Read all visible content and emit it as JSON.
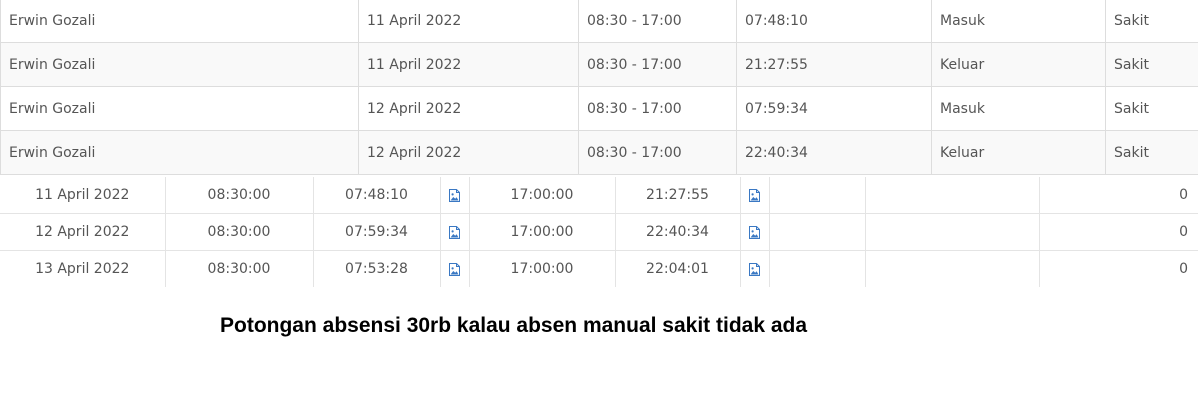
{
  "log_rows": [
    {
      "name": "Erwin Gozali",
      "date": "11 April 2022",
      "shift": "08:30 - 17:00",
      "time": "07:48:10",
      "type": "Masuk",
      "reason": "Sakit"
    },
    {
      "name": "Erwin Gozali",
      "date": "11 April 2022",
      "shift": "08:30 - 17:00",
      "time": "21:27:55",
      "type": "Keluar",
      "reason": "Sakit"
    },
    {
      "name": "Erwin Gozali",
      "date": "12 April 2022",
      "shift": "08:30 - 17:00",
      "time": "07:59:34",
      "type": "Masuk",
      "reason": "Sakit"
    },
    {
      "name": "Erwin Gozali",
      "date": "12 April 2022",
      "shift": "08:30 - 17:00",
      "time": "22:40:34",
      "type": "Keluar",
      "reason": "Sakit"
    }
  ],
  "summary_rows": [
    {
      "date": "11 April 2022",
      "sched_in": "08:30:00",
      "actual_in": "07:48:10",
      "sched_out": "17:00:00",
      "actual_out": "21:27:55",
      "col8": "",
      "col9": "",
      "deduction": "0"
    },
    {
      "date": "12 April 2022",
      "sched_in": "08:30:00",
      "actual_in": "07:59:34",
      "sched_out": "17:00:00",
      "actual_out": "22:40:34",
      "col8": "",
      "col9": "",
      "deduction": "0"
    },
    {
      "date": "13 April 2022",
      "sched_in": "08:30:00",
      "actual_in": "07:53:28",
      "sched_out": "17:00:00",
      "actual_out": "22:04:01",
      "col8": "",
      "col9": "",
      "deduction": "0"
    }
  ],
  "note": "Potongan absensi 30rb kalau absen manual sakit tidak ada",
  "colors": {
    "icon_accent": "#3a78c3",
    "border": "#dddddd",
    "stripe": "#f9f9f9",
    "text": "#555555"
  },
  "icons": {
    "photo": "image-icon"
  }
}
